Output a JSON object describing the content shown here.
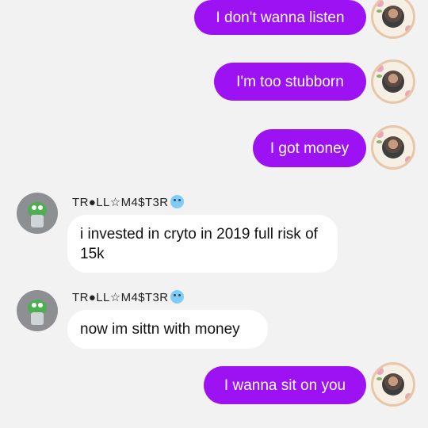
{
  "conversation": {
    "outgoing_messages": [
      {
        "text": "I don't wanna listen"
      },
      {
        "text": "I'm too stubborn"
      },
      {
        "text": "I got money"
      },
      {
        "text": "I wanna sit on you"
      }
    ],
    "incoming_messages": [
      {
        "sender": "TR●LL☆M4$T3R",
        "text": "i invested in cryto in 2019 full risk of 15k"
      },
      {
        "sender": "TR●LL☆M4$T3R",
        "text": "now im sittn with money"
      }
    ]
  },
  "colors": {
    "outgoing_bubble": "#9d12f2",
    "incoming_bubble": "#ffffff",
    "background": "#f2f2f2"
  },
  "icons": {
    "outgoing_avatar": "floral-frame-avatar-icon",
    "incoming_avatar": "green-monster-avatar-icon",
    "sender_emoji": "cold-face-emoji-icon"
  }
}
